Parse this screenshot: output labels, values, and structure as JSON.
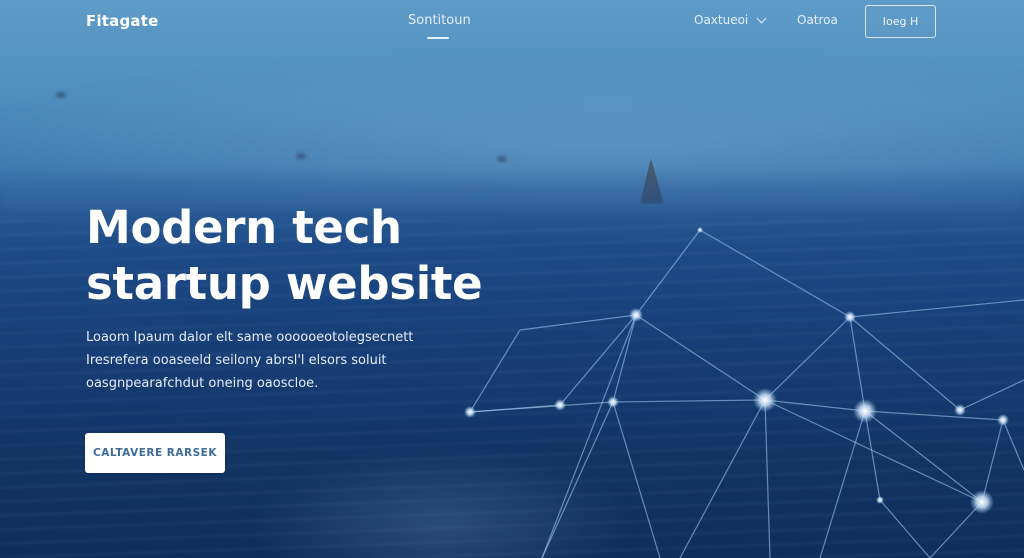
{
  "nav": {
    "logo": "Fitagate",
    "center_link": "Sontitoun",
    "dropdown_label": "Oaxtueoi",
    "link": "Oatroa",
    "login_button": "Ioeg H"
  },
  "hero": {
    "headline_line1": "Modern tech",
    "headline_line2": "startup website",
    "body_line1": "Loaom Ipaum dalor elt same oooooeotolegsecnett",
    "body_line2": "Iresrefera ooaseeld seilony abrsl'l elsors soluit",
    "body_line3": "oasgnpearafchdut oneing oaoscloe.",
    "cta_label": "CALTAVERE RARSEK"
  },
  "colors": {
    "sky": "#5e9bc8",
    "sea": "#173f78",
    "deep_sea": "#0f2e5a",
    "network_line": "#9cc8ef",
    "cta_bg": "#ffffff",
    "cta_text": "#3d6b9a"
  },
  "icons": {
    "dropdown": "chevron-down-icon"
  }
}
